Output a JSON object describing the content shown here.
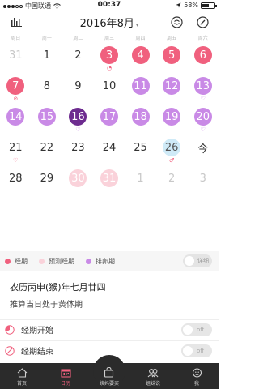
{
  "status_bar": {
    "carrier": "中国联通",
    "time": "00:37",
    "battery_text": "58%",
    "battery_level": 0.58
  },
  "header": {
    "title": "2016年8月",
    "caret": "▾"
  },
  "weekdays": [
    "周日",
    "周一",
    "周二",
    "周三",
    "周四",
    "周五",
    "周六"
  ],
  "calendar": [
    {
      "text": "31",
      "style": "muted"
    },
    {
      "text": "1",
      "style": ""
    },
    {
      "text": "2",
      "style": ""
    },
    {
      "text": "3",
      "style": "period",
      "mark": "◔",
      "mark_color": "pink"
    },
    {
      "text": "4",
      "style": "period"
    },
    {
      "text": "5",
      "style": "period"
    },
    {
      "text": "6",
      "style": "period"
    },
    {
      "text": "7",
      "style": "period",
      "mark": "⊘",
      "mark_color": "pink"
    },
    {
      "text": "8",
      "style": ""
    },
    {
      "text": "9",
      "style": ""
    },
    {
      "text": "10",
      "style": ""
    },
    {
      "text": "11",
      "style": "ovul"
    },
    {
      "text": "12",
      "style": "ovul"
    },
    {
      "text": "13",
      "style": "ovul",
      "mark": "♡",
      "mark_color": "purple"
    },
    {
      "text": "14",
      "style": "ovul"
    },
    {
      "text": "15",
      "style": "ovul"
    },
    {
      "text": "16",
      "style": "ovulday",
      "mark": "♡",
      "mark_color": "purple"
    },
    {
      "text": "17",
      "style": "ovul"
    },
    {
      "text": "18",
      "style": "ovul"
    },
    {
      "text": "19",
      "style": "ovul"
    },
    {
      "text": "20",
      "style": "ovul",
      "mark": "♡",
      "mark_color": "purple"
    },
    {
      "text": "21",
      "style": "",
      "mark": "♡",
      "mark_color": "pink"
    },
    {
      "text": "22",
      "style": ""
    },
    {
      "text": "23",
      "style": ""
    },
    {
      "text": "24",
      "style": ""
    },
    {
      "text": "25",
      "style": ""
    },
    {
      "text": "26",
      "style": "today",
      "mark": "♂",
      "mark_color": "pink"
    },
    {
      "text": "今",
      "style": ""
    },
    {
      "text": "28",
      "style": ""
    },
    {
      "text": "29",
      "style": ""
    },
    {
      "text": "30",
      "style": "predict"
    },
    {
      "text": "31",
      "style": "predict"
    },
    {
      "text": "1",
      "style": "muted"
    },
    {
      "text": "2",
      "style": "muted"
    },
    {
      "text": "3",
      "style": "muted"
    }
  ],
  "legend": {
    "period": "经期",
    "predict": "预测经期",
    "ovulation": "排卵期",
    "detail_label": "详细",
    "colors": {
      "period": "#f0607e",
      "predict": "#fad2da",
      "ovulation": "#c98ae6"
    }
  },
  "info": {
    "lunar": "农历丙申(猴)年七月廿四",
    "phase": "推算当日处于黄体期"
  },
  "rows": [
    {
      "label": "经期开始",
      "toggle": "off"
    },
    {
      "label": "经期结束",
      "toggle": "off"
    }
  ],
  "tabs": [
    {
      "label": "首页"
    },
    {
      "label": "日历"
    },
    {
      "label": "姨妈要买"
    },
    {
      "label": "姐妹说"
    },
    {
      "label": "我"
    }
  ]
}
